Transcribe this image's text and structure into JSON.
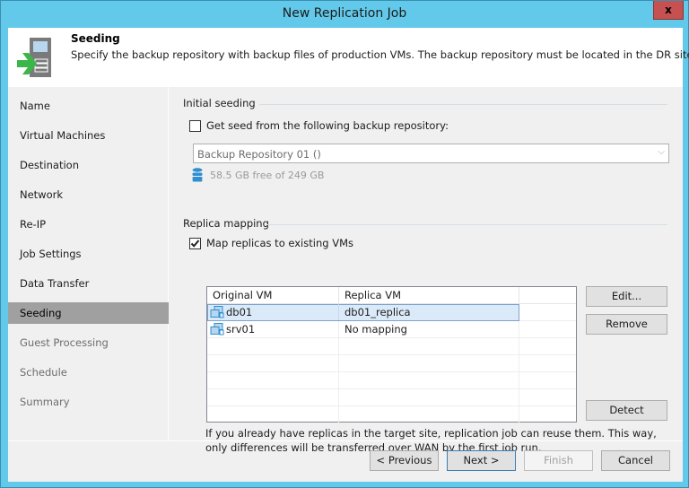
{
  "window": {
    "title": "New Replication Job",
    "close_label": "x"
  },
  "header": {
    "title": "Seeding",
    "description": "Specify the backup repository with backup files of production VMs. The backup repository must be located in the DR site.",
    "icon": "seeding-server-arrow-icon"
  },
  "sidebar": {
    "items": [
      {
        "label": "Name",
        "state": "normal"
      },
      {
        "label": "Virtual Machines",
        "state": "normal"
      },
      {
        "label": "Destination",
        "state": "normal"
      },
      {
        "label": "Network",
        "state": "normal"
      },
      {
        "label": "Re-IP",
        "state": "normal"
      },
      {
        "label": "Job Settings",
        "state": "normal"
      },
      {
        "label": "Data Transfer",
        "state": "normal"
      },
      {
        "label": "Seeding",
        "state": "active"
      },
      {
        "label": "Guest Processing",
        "state": "disabled"
      },
      {
        "label": "Schedule",
        "state": "disabled"
      },
      {
        "label": "Summary",
        "state": "disabled"
      }
    ]
  },
  "initial_seeding": {
    "group_label": "Initial seeding",
    "checkbox_label": "Get seed from the following backup repository:",
    "checked": false,
    "repository_selected": "Backup Repository 01 ()",
    "repository_info": "58.5 GB free of 249 GB"
  },
  "replica_mapping": {
    "group_label": "Replica mapping",
    "checkbox_label": "Map replicas to existing VMs",
    "checked": true,
    "columns": [
      "Original VM",
      "Replica VM",
      ""
    ],
    "rows": [
      {
        "original": "db01",
        "replica": "db01_replica",
        "selected": true
      },
      {
        "original": "srv01",
        "replica": "No mapping",
        "selected": false
      }
    ],
    "buttons": {
      "edit": "Edit...",
      "remove": "Remove",
      "detect": "Detect"
    },
    "hint": "If you already have replicas in the target site, replication job can reuse them. This way, only differences will be transferred over WAN by the first job run."
  },
  "footer": {
    "previous": "< Previous",
    "next": "Next >",
    "finish": "Finish",
    "cancel": "Cancel"
  },
  "colors": {
    "window_frame": "#63c9ea",
    "close_button": "#c75050",
    "active_nav": "#a0a0a0",
    "selection": "#dbeaf9",
    "icon_green": "#3cb54a",
    "icon_blue": "#2f8fd0"
  }
}
